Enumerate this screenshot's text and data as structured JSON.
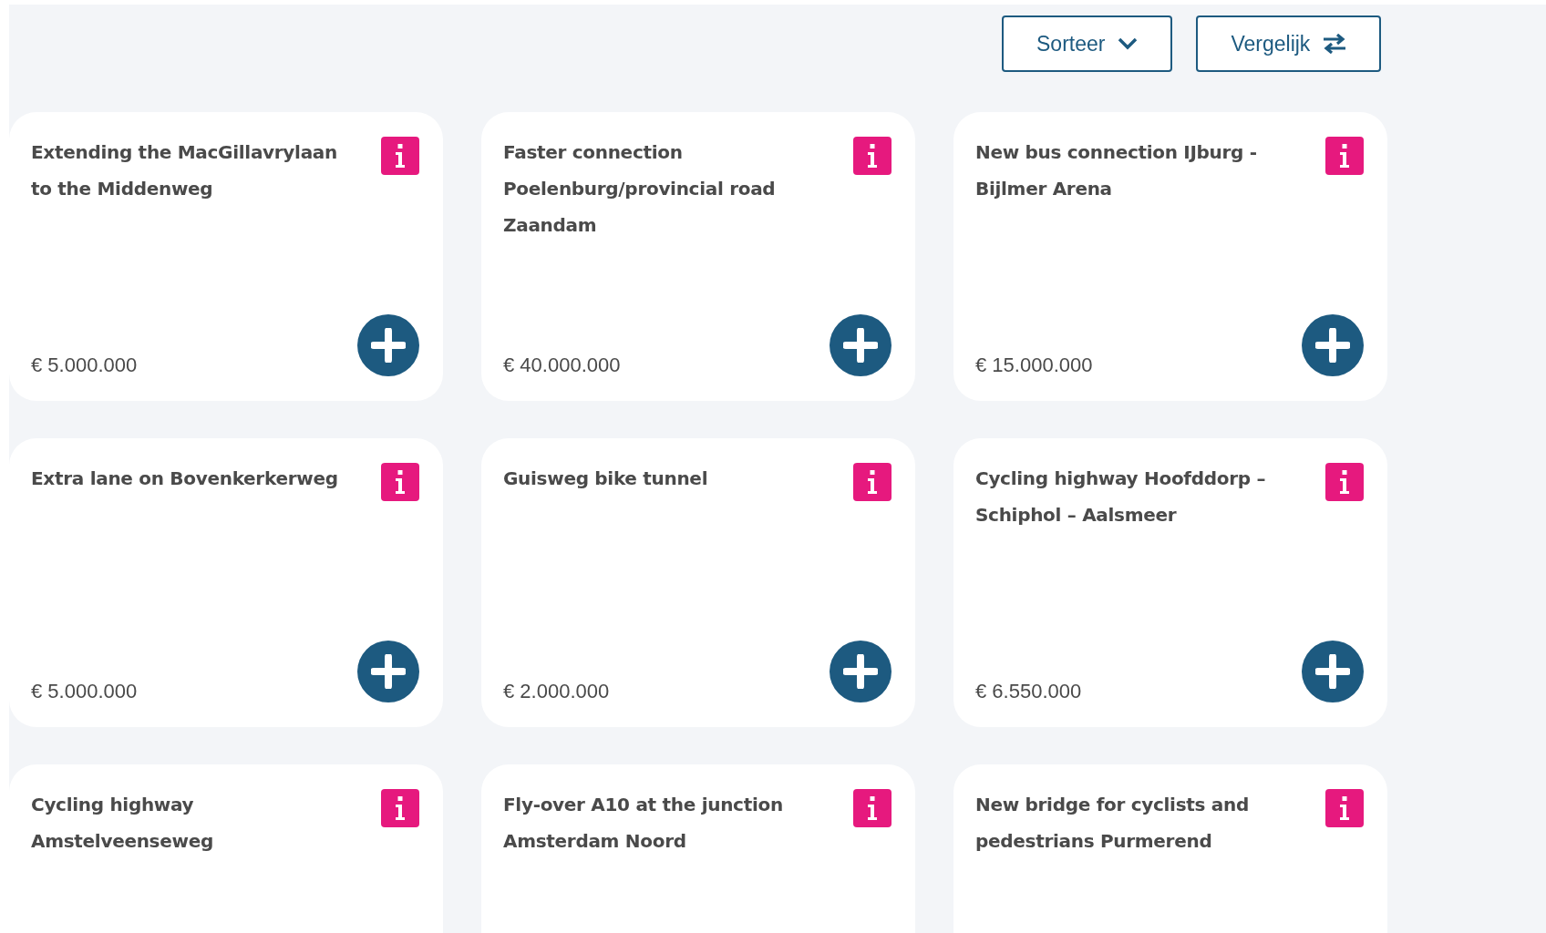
{
  "toolbar": {
    "buttons": [
      {
        "label": "Sorteer",
        "kind": "sort"
      },
      {
        "label": "Vergelijk",
        "kind": "compare"
      }
    ]
  },
  "projects": [
    {
      "title": "Extending the MacGillavrylaan to the Middenweg",
      "price": "€ 5.000.000"
    },
    {
      "title": "Faster connection Poelenburg/provincial road Zaandam",
      "price": "€ 40.000.000"
    },
    {
      "title": "New bus connection IJburg - Bijlmer Arena",
      "price": "€ 15.000.000"
    },
    {
      "title": "Extra lane on Bovenkerkerweg",
      "price": "€ 5.000.000"
    },
    {
      "title": "Guisweg bike tunnel",
      "price": "€ 2.000.000"
    },
    {
      "title": "Cycling highway Hoofddorp – Schiphol – Aalsmeer",
      "price": "€ 6.550.000"
    },
    {
      "title": "Cycling highway Amstelveenseweg"
    },
    {
      "title": "Fly-over A10 at the junction Amsterdam Noord"
    },
    {
      "title": "New bridge for cyclists and pedestrians Purmerend"
    }
  ]
}
